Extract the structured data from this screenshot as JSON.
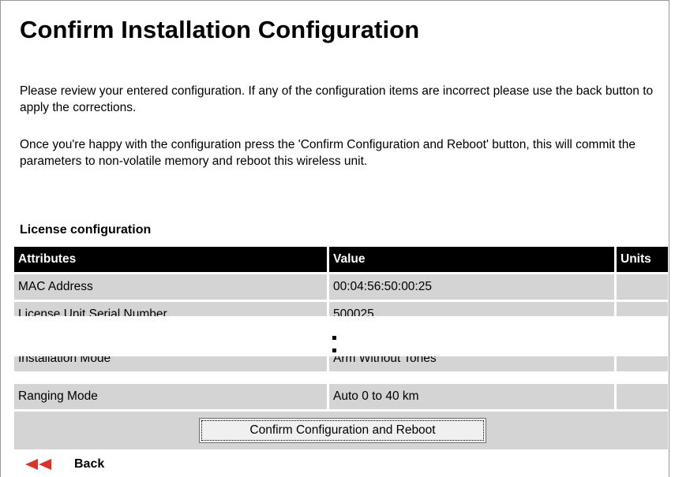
{
  "page": {
    "title": "Confirm Installation Configuration",
    "intro_1": "Please review your entered configuration. If any of the configuration items are incorrect please use the back button to apply the corrections.",
    "intro_2": "Once you're happy with the configuration press the 'Confirm Configuration and Reboot' button, this will commit the parameters to non-volatile memory and reboot this wireless unit."
  },
  "license": {
    "section_title": "License configuration",
    "columns": [
      "Attributes",
      "Value",
      "Units"
    ],
    "rows": [
      {
        "attribute": "MAC Address",
        "value": "00:04:56:50:00:25",
        "units": ""
      },
      {
        "attribute": "License Unit Serial Number",
        "value": "500025",
        "units": ""
      },
      {
        "attribute": "Installation Mode",
        "value": "Arm Without Tones",
        "units": ""
      },
      {
        "attribute": "Ranging Mode",
        "value": "Auto 0 to 40 km",
        "units": ""
      }
    ]
  },
  "actions": {
    "confirm_label": "Confirm Configuration and Reboot",
    "back_label": "Back"
  },
  "colors": {
    "header_bg": "#000000",
    "row_bg": "#d4d4d4",
    "back_arrow": "#d9342b"
  },
  "icons": {
    "back": "double-left-arrow-icon"
  }
}
